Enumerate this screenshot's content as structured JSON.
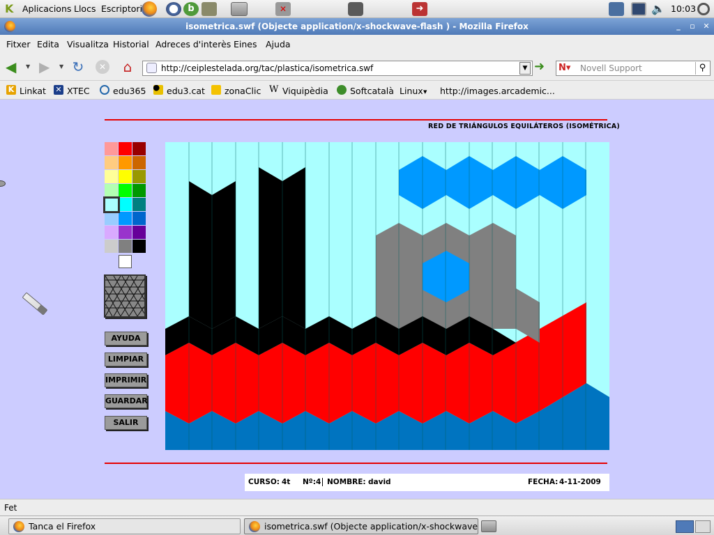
{
  "panel": {
    "menus": [
      "Aplicacions",
      "Llocs",
      "Escriptori"
    ],
    "clock": "10:03"
  },
  "window": {
    "title": "isometrica.swf (Objecte application/x-shockwave-flash ) - Mozilla Firefox"
  },
  "menubar": [
    "Fitxer",
    "Edita",
    "Visualitza",
    "Historial",
    "Adreces d'interès",
    "Eines",
    "Ajuda"
  ],
  "navbar": {
    "url": "http://ceiplestelada.org/tac/plastica/isometrica.swf",
    "search_placeholder": "Novell Support"
  },
  "bookmarks": [
    "Linkat",
    "XTEC",
    "edu365",
    "edu3.cat",
    "zonaClic",
    "Viquipèdia",
    "Softcatalà",
    "Linux",
    "http://images.arcademic..."
  ],
  "app": {
    "heading": "RED DE TRIÁNGULOS EQUILÁTEROS (ISOMÉTRICA)",
    "palette": [
      "#ff9999",
      "#ff0000",
      "#990000",
      "#ffcc80",
      "#ff9900",
      "#cc6600",
      "#ffff99",
      "#ffff00",
      "#999900",
      "#b3ffb3",
      "#00ff00",
      "#009900",
      "#aaffff",
      "#00ffff",
      "#008080",
      "#99ccff",
      "#0099ff",
      "#0066cc",
      "#d9aaff",
      "#9933cc",
      "#660099",
      "#cccccc",
      "#808080",
      "#000000"
    ],
    "selected_color": "#aaffff",
    "white": "#ffffff",
    "buttons": {
      "help": "AYUDA",
      "clear": "LIMPIAR",
      "print": "IMPRIMIR",
      "save": "GUARDAR",
      "exit": "SALIR"
    },
    "info": {
      "course_label": "CURSO:",
      "course": "4t",
      "number_label": "Nº:",
      "number": "4",
      "name_label": "NOMBRE:",
      "name": "david",
      "date_label": "FECHA:",
      "date": "4-11-2009"
    }
  },
  "status": "Fet",
  "taskbar": [
    "Tanca el Firefox",
    "isometrica.swf (Objecte application/x-shockwave-fl..."
  ]
}
